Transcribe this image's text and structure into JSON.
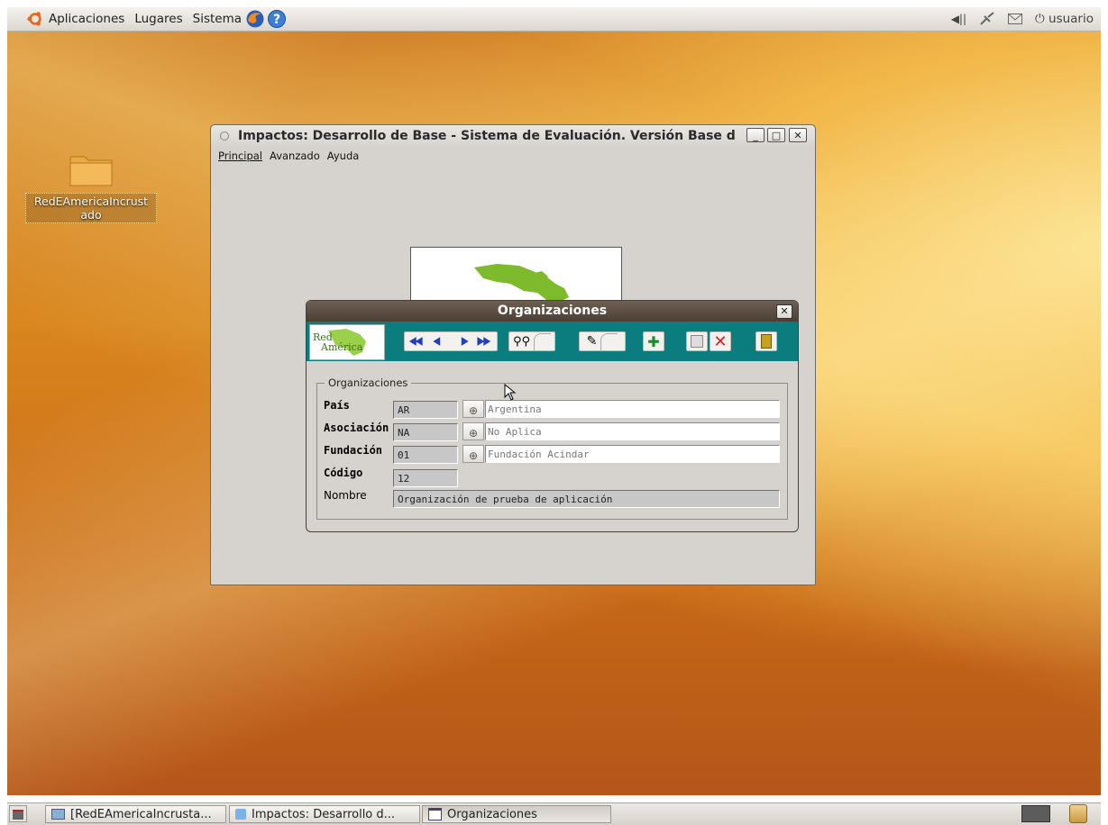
{
  "top_panel": {
    "menus": [
      "Aplicaciones",
      "Lugares",
      "Sistema"
    ],
    "user": "usuario"
  },
  "desktop_icon": {
    "label_line1": "RedEAmericaIncrust",
    "label_line2": "ado"
  },
  "main_window": {
    "title": "Impactos: Desarrollo de Base - Sistema de Evaluación. Versión Base d",
    "menu": [
      "Principal",
      "Avanzado",
      "Ayuda"
    ]
  },
  "dialog": {
    "title": "Organizaciones",
    "fieldset_legend": "Organizaciones",
    "fields": [
      {
        "label": "País",
        "code": "AR",
        "description": "Argentina"
      },
      {
        "label": "Asociación",
        "code": "NA",
        "description": "No Aplica"
      },
      {
        "label": "Fundación",
        "code": "01",
        "description": "Fundación Acindar"
      }
    ],
    "codigo_label": "Código",
    "codigo_value": "12",
    "nombre_label": "Nombre",
    "nombre_value": "Organización de prueba de aplicación",
    "logo_text": "RedAmérica"
  },
  "taskbar": {
    "tasks": [
      "[RedEAmericaIncrusta...",
      "Impactos: Desarrollo d...",
      "Organizaciones"
    ]
  },
  "colors": {
    "toolbar_bg": "#0b7d7f",
    "dialog_title_bg": "#4b3f35",
    "window_bg": "#d6d3ce"
  }
}
